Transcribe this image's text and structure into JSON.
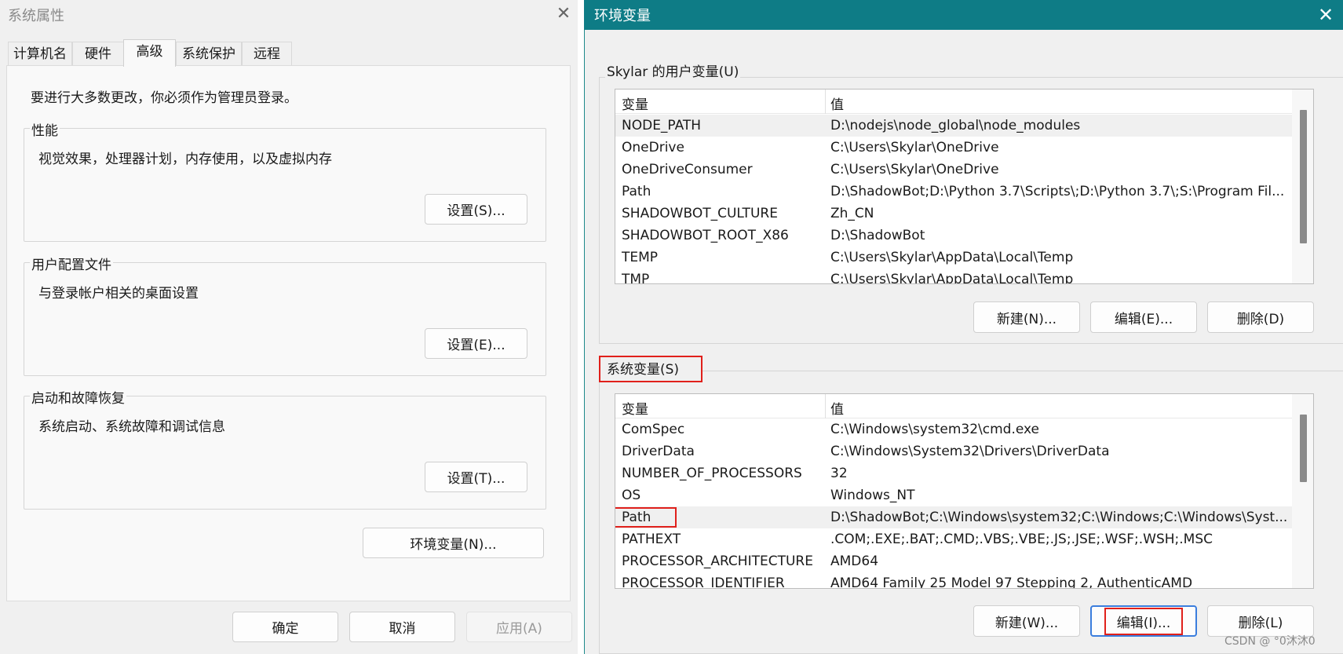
{
  "sysprops": {
    "title": "系统属性",
    "tabs": [
      {
        "label": "计算机名"
      },
      {
        "label": "硬件"
      },
      {
        "label": "高级"
      },
      {
        "label": "系统保护"
      },
      {
        "label": "远程"
      }
    ],
    "notice": "要进行大多数更改，你必须作为管理员登录。",
    "performance": {
      "title": "性能",
      "desc": "视觉效果，处理器计划，内存使用，以及虚拟内存",
      "button": "设置(S)..."
    },
    "profile": {
      "title": "用户配置文件",
      "desc": "与登录帐户相关的桌面设置",
      "button": "设置(E)..."
    },
    "startup": {
      "title": "启动和故障恢复",
      "desc": "系统启动、系统故障和调试信息",
      "button": "设置(T)..."
    },
    "env_button": "环境变量(N)...",
    "ok": "确定",
    "cancel": "取消",
    "apply": "应用(A)"
  },
  "envvars": {
    "title": "环境变量",
    "user_label": "Skylar 的用户变量(U)",
    "system_label": "系统变量(S)",
    "col_var": "变量",
    "col_val": "值",
    "user_vars": [
      {
        "name": "NODE_PATH",
        "value": "D:\\nodejs\\node_global\\node_modules"
      },
      {
        "name": "OneDrive",
        "value": "C:\\Users\\Skylar\\OneDrive"
      },
      {
        "name": "OneDriveConsumer",
        "value": "C:\\Users\\Skylar\\OneDrive"
      },
      {
        "name": "Path",
        "value": "D:\\ShadowBot;D:\\Python 3.7\\Scripts\\;D:\\Python 3.7\\;S:\\Program Fil..."
      },
      {
        "name": "SHADOWBOT_CULTURE",
        "value": "Zh_CN"
      },
      {
        "name": "SHADOWBOT_ROOT_X86",
        "value": "D:\\ShadowBot"
      },
      {
        "name": "TEMP",
        "value": "C:\\Users\\Skylar\\AppData\\Local\\Temp"
      },
      {
        "name": "TMP",
        "value": "C:\\Users\\Skylar\\AppData\\Local\\Temp"
      }
    ],
    "system_vars": [
      {
        "name": "ComSpec",
        "value": "C:\\Windows\\system32\\cmd.exe"
      },
      {
        "name": "DriverData",
        "value": "C:\\Windows\\System32\\Drivers\\DriverData"
      },
      {
        "name": "NUMBER_OF_PROCESSORS",
        "value": "32"
      },
      {
        "name": "OS",
        "value": "Windows_NT"
      },
      {
        "name": "Path",
        "value": "D:\\ShadowBot;C:\\Windows\\system32;C:\\Windows;C:\\Windows\\Syst..."
      },
      {
        "name": "PATHEXT",
        "value": ".COM;.EXE;.BAT;.CMD;.VBS;.VBE;.JS;.JSE;.WSF;.WSH;.MSC"
      },
      {
        "name": "PROCESSOR_ARCHITECTURE",
        "value": "AMD64"
      },
      {
        "name": "PROCESSOR_IDENTIFIER",
        "value": "AMD64 Family 25 Model 97 Stepping 2, AuthenticAMD"
      }
    ],
    "user_buttons": {
      "new": "新建(N)...",
      "edit": "编辑(E)...",
      "delete": "删除(D)"
    },
    "system_buttons": {
      "new": "新建(W)...",
      "edit": "编辑(I)...",
      "delete": "删除(L)"
    },
    "highlight_color": "#e0201b",
    "titlebar_color": "#0e7c86"
  },
  "watermark": "CSDN @ °0沐沐0"
}
